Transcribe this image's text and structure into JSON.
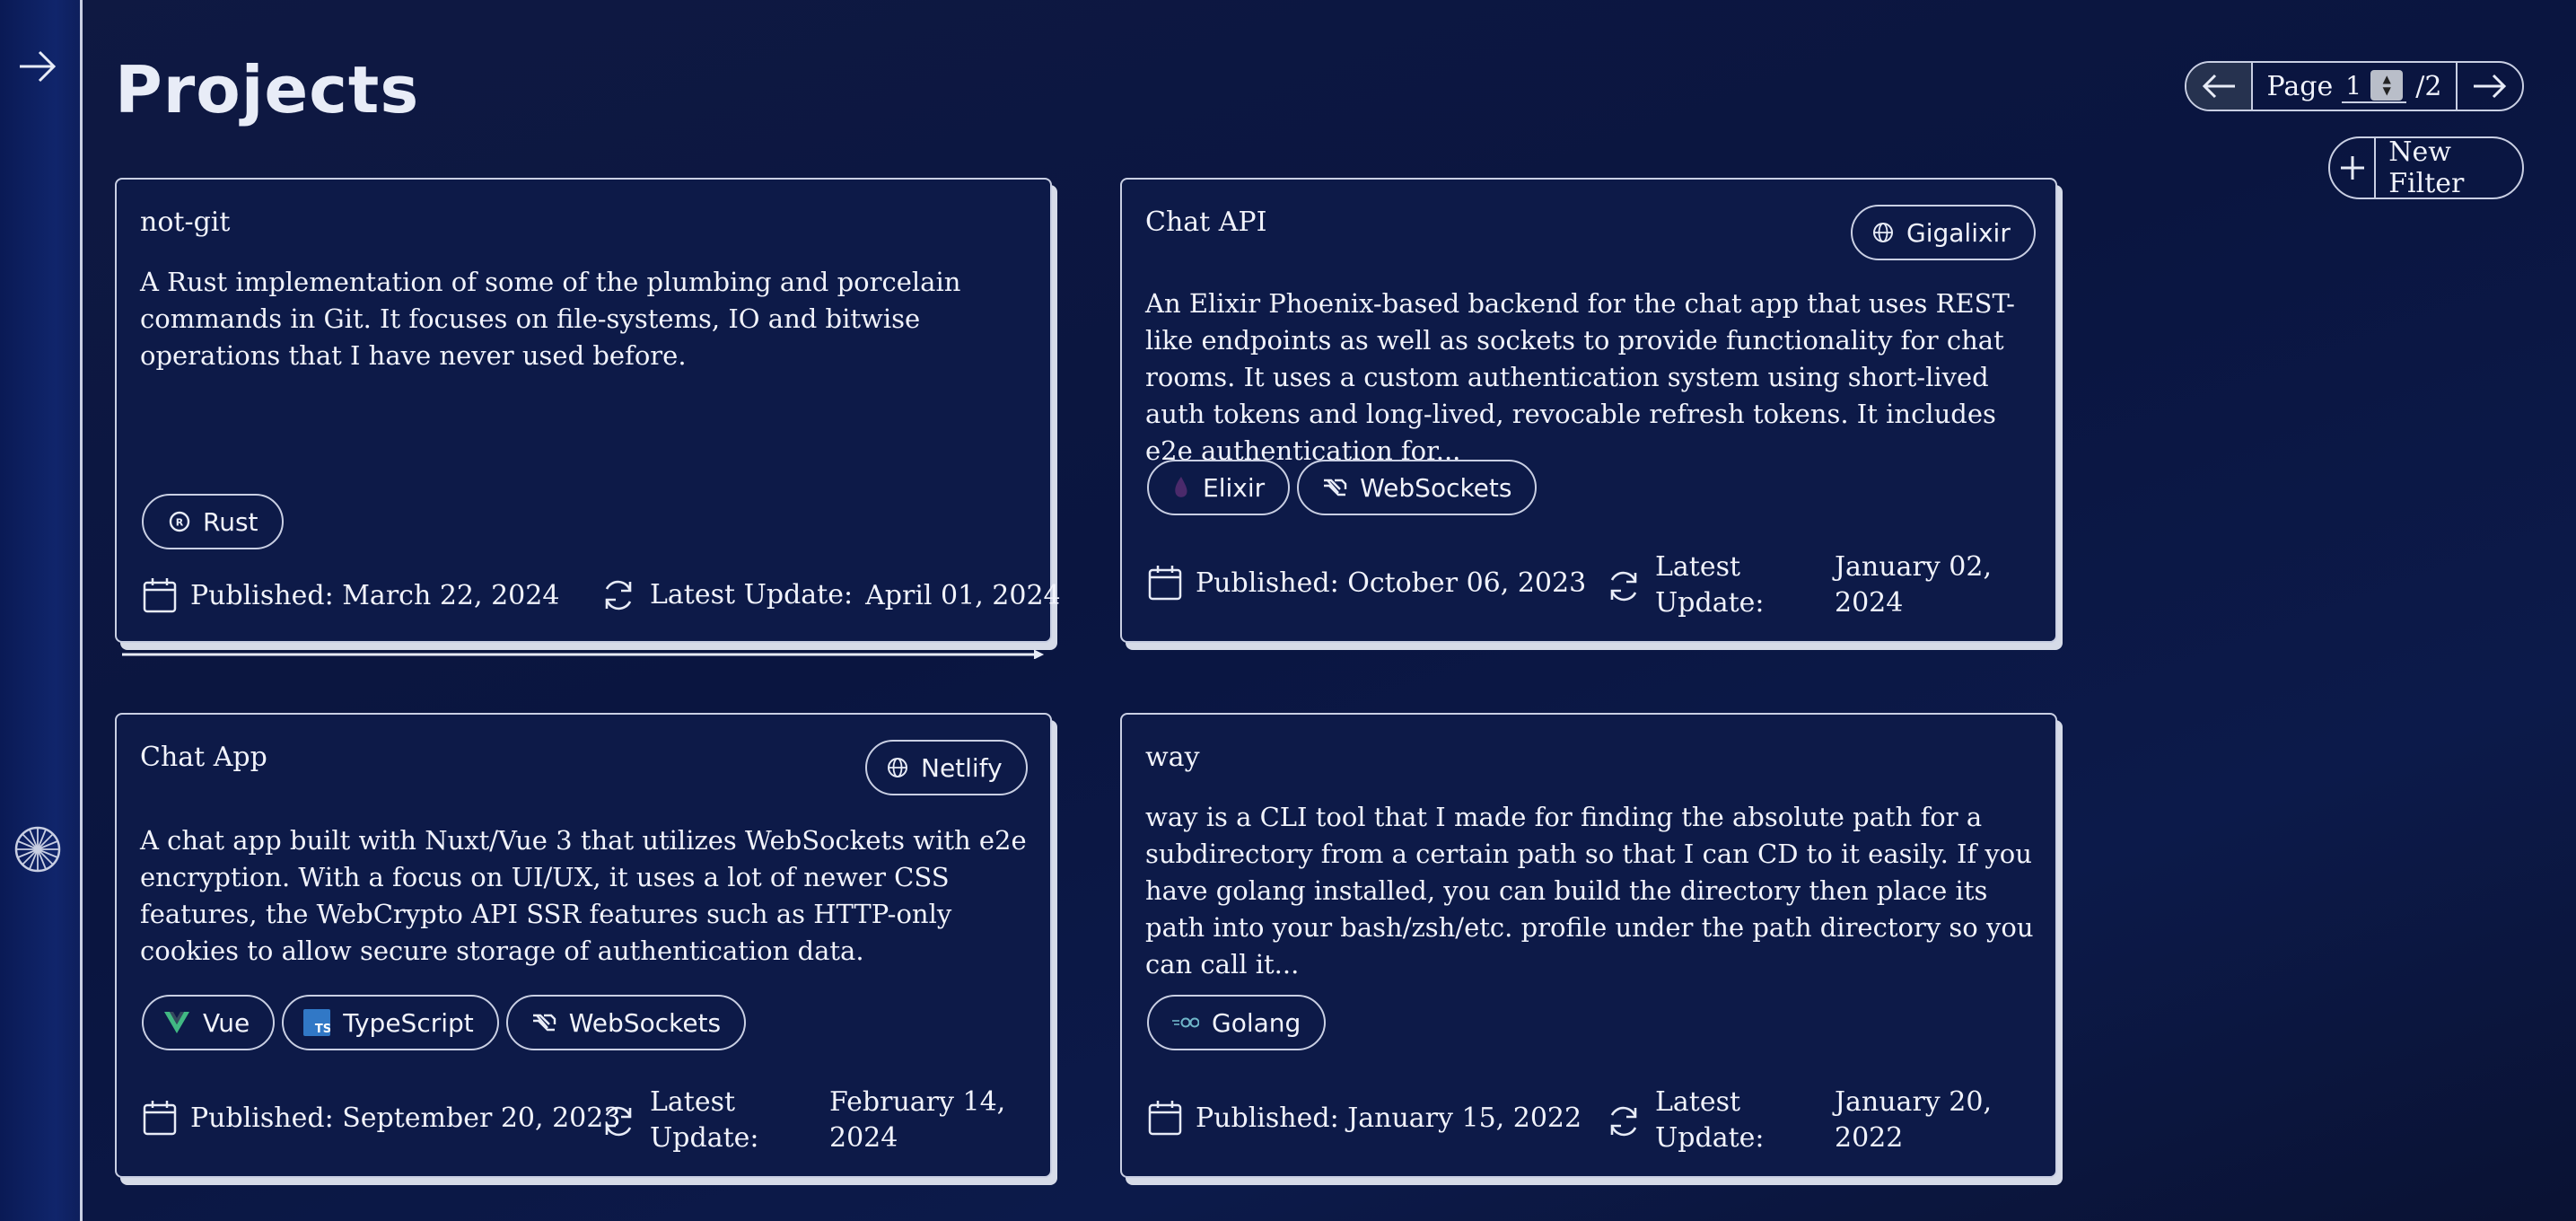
{
  "page": {
    "title": "Projects"
  },
  "pagination": {
    "label": "Page",
    "current": "1",
    "total_text": "/2"
  },
  "filter": {
    "new_label": "New Filter"
  },
  "cards": [
    {
      "title": "not-git",
      "description": "A Rust implementation of some of the plumbing and porcelain commands in Git. It focuses on file-systems, IO and bitwise operations that I have never used before.",
      "host": "",
      "tags": [
        "Rust"
      ],
      "published": "Published: March 22, 2024",
      "update_label": "Latest Update:",
      "update_date": "April 01, 2024"
    },
    {
      "title": "Chat API",
      "description": "An Elixir Phoenix-based backend for the chat app that uses REST-like endpoints as well as sockets to provide functionality for chat rooms. It uses a custom authentication system using short-lived auth tokens and long-lived, revocable refresh tokens. It includes e2e authentication for...",
      "host": "Gigalixir",
      "tags": [
        "Elixir",
        "WebSockets"
      ],
      "published": "Published: October 06, 2023",
      "update_label": "Latest Update:",
      "update_date": "January 02, 2024"
    },
    {
      "title": "Chat App",
      "description": "A chat app built with Nuxt/Vue 3 that utilizes WebSockets with e2e encryption. With a focus on UI/UX, it uses a lot of newer CSS features, the WebCrypto API SSR features such as HTTP-only cookies to allow secure storage of authentication data.",
      "host": "Netlify",
      "tags": [
        "Vue",
        "TypeScript",
        "WebSockets"
      ],
      "published": "Published: September 20, 2023",
      "update_label": "Latest Update:",
      "update_date": "February 14, 2024"
    },
    {
      "title": "way",
      "description": "way is a CLI tool that I made for finding the absolute path for a subdirectory from a certain path so that I can CD to it easily. If you have golang installed, you can build the directory then place its path into your bash/zsh/etc. profile under the path directory so you can call it...",
      "host": "",
      "tags": [
        "Golang"
      ],
      "published": "Published: January 15, 2022",
      "update_label": "Latest Update:",
      "update_date": "January 20, 2022"
    }
  ],
  "icons": {
    "sidebar_expand": "arrow-right-icon",
    "sidebar_logo": "wheel-icon",
    "pager_prev": "arrow-left-icon",
    "pager_next": "arrow-right-icon",
    "filter_add": "plus-icon",
    "host": "globe-icon",
    "published": "calendar-icon",
    "update": "refresh-icon"
  }
}
